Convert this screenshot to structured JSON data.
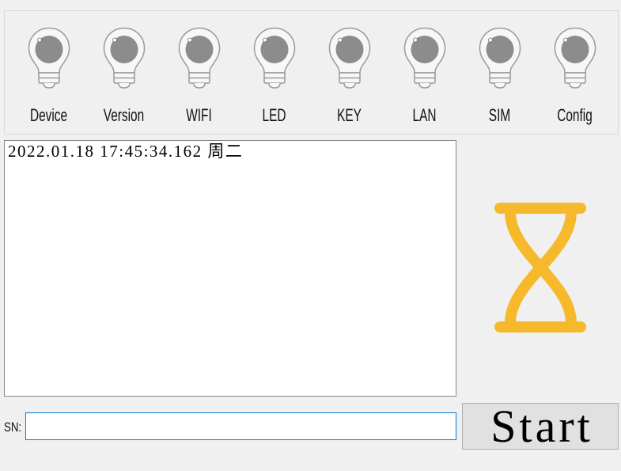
{
  "window": {
    "background": "#F0F0F0"
  },
  "indicators": [
    {
      "label": "Device",
      "icon": "lightbulb-icon",
      "color": "#8C8C8C"
    },
    {
      "label": "Version",
      "icon": "lightbulb-icon",
      "color": "#8C8C8C"
    },
    {
      "label": "WIFI",
      "icon": "lightbulb-icon",
      "color": "#8C8C8C"
    },
    {
      "label": "LED",
      "icon": "lightbulb-icon",
      "color": "#8C8C8C"
    },
    {
      "label": "KEY",
      "icon": "lightbulb-icon",
      "color": "#8C8C8C"
    },
    {
      "label": "LAN",
      "icon": "lightbulb-icon",
      "color": "#8C8C8C"
    },
    {
      "label": "SIM",
      "icon": "lightbulb-icon",
      "color": "#8C8C8C"
    },
    {
      "label": "Config",
      "icon": "lightbulb-icon",
      "color": "#8C8C8C"
    }
  ],
  "log": {
    "lines": [
      "2022.01.18 17:45:34.162 周二"
    ]
  },
  "busy_indicator": {
    "icon": "hourglass-icon",
    "color": "#F6B92B"
  },
  "sn": {
    "label": "SN:",
    "value": ""
  },
  "start_button": {
    "label": "Start"
  },
  "colors": {
    "input_focus_border": "#0078D7",
    "button_face": "#E1E1E1",
    "button_border": "#ADADAD",
    "log_border": "#828790"
  }
}
